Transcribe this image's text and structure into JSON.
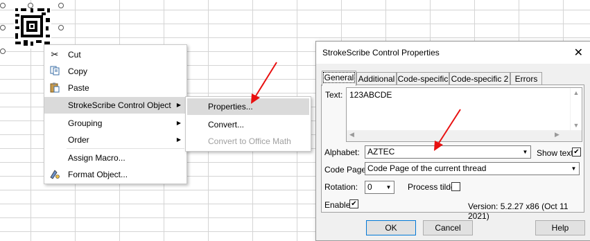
{
  "context_menu": {
    "items": [
      {
        "label": "Cut",
        "icon": "scissors-icon"
      },
      {
        "label": "Copy",
        "icon": "copy-icon"
      },
      {
        "label": "Paste",
        "icon": "paste-icon"
      },
      {
        "label": "StrokeScribe Control Object",
        "has_submenu": true
      },
      {
        "label": "Grouping",
        "has_submenu": true
      },
      {
        "label": "Order",
        "has_submenu": true
      },
      {
        "label": "Assign Macro..."
      },
      {
        "label": "Format Object...",
        "icon": "format-object-icon"
      }
    ]
  },
  "submenu": {
    "items": [
      {
        "label": "Properties..."
      },
      {
        "label": "Convert..."
      },
      {
        "label": "Convert to Office Math",
        "disabled": true
      }
    ]
  },
  "dialog": {
    "title": "StrokeScribe Control Properties",
    "tabs": [
      "General",
      "Additional",
      "Code-specific",
      "Code-specific 2",
      "Errors"
    ],
    "text_label": "Text:",
    "text_value": "123ABCDE",
    "alphabet_label": "Alphabet:",
    "alphabet_value": "AZTEC",
    "show_text_label": "Show text",
    "show_text_checked": true,
    "code_page_label": "Code Page:",
    "code_page_value": "Code Page of the current thread",
    "rotation_label": "Rotation:",
    "rotation_value": "0",
    "process_tilde_label": "Process tilde",
    "process_tilde_checked": false,
    "enable_label": "Enable",
    "enable_checked": true,
    "version": "Version: 5.2.27 x86 (Oct 11 2021)",
    "ok_label": "OK",
    "cancel_label": "Cancel",
    "help_label": "Help"
  },
  "colors": {
    "arrow": "#e81010",
    "highlight": "#dadada"
  }
}
